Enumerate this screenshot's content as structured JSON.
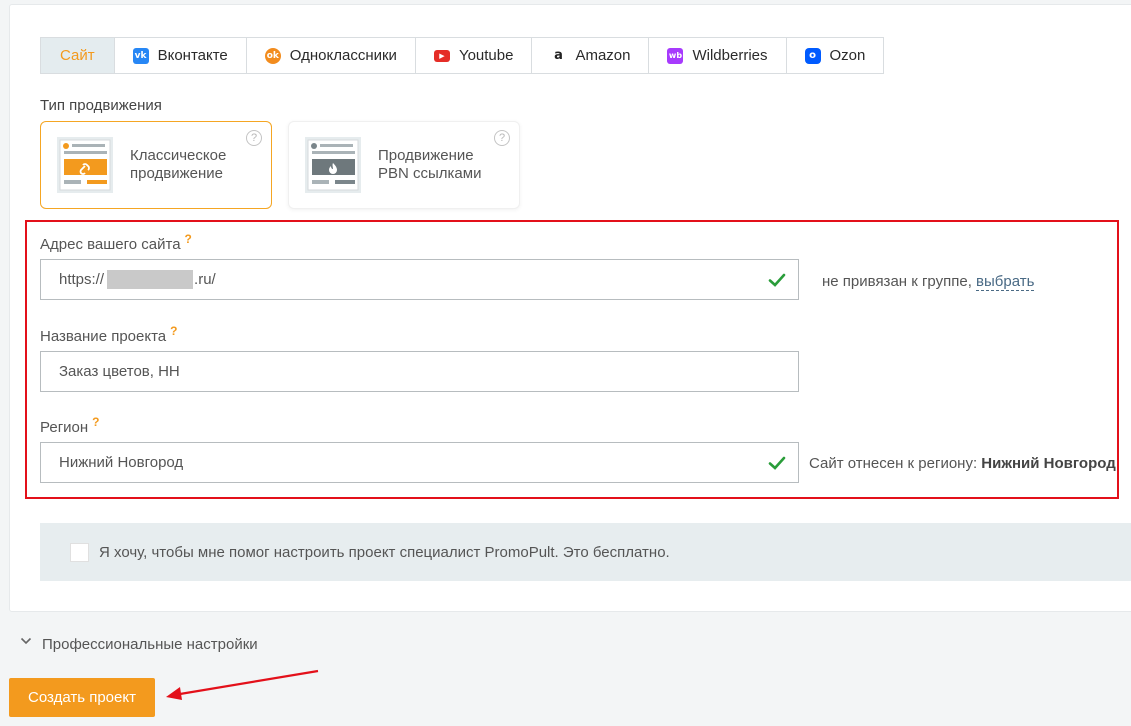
{
  "tabs": [
    {
      "label": "Сайт",
      "icon": "site-icon",
      "color": "",
      "glyph": ""
    },
    {
      "label": "Вконтакте",
      "icon": "vk-icon",
      "color": "#2787f5",
      "glyph": "vk"
    },
    {
      "label": "Одноклассники",
      "icon": "odnoklassniki-icon",
      "color": "#f28c1e",
      "glyph": "ok"
    },
    {
      "label": "Youtube",
      "icon": "youtube-icon",
      "color": "#e52d27",
      "glyph": "▶"
    },
    {
      "label": "Amazon",
      "icon": "amazon-icon",
      "color": "",
      "glyph": "a"
    },
    {
      "label": "Wildberries",
      "icon": "wildberries-icon",
      "color": "#a73afd",
      "glyph": "wb"
    },
    {
      "label": "Ozon",
      "icon": "ozon-icon",
      "color": "#005bff",
      "glyph": "o"
    }
  ],
  "promotion": {
    "label": "Тип продвижения",
    "options": [
      {
        "line1": "Классическое",
        "line2": "продвижение",
        "help": "?"
      },
      {
        "line1": "Продвижение",
        "line2": "PBN ссылками",
        "help": "?"
      }
    ]
  },
  "fields": {
    "site": {
      "label": "Адрес вашего сайта",
      "help": "?",
      "prefix": "https://",
      "suffix": ".ru/",
      "note": "не привязан к группе,",
      "note_link": "выбрать"
    },
    "project": {
      "label": "Название проекта",
      "help": "?",
      "value": "Заказ цветов, НН"
    },
    "region": {
      "label": "Регион",
      "help": "?",
      "value": "Нижний Новгород",
      "note": "Сайт отнесен к региону:",
      "note_value": "Нижний Новгород"
    }
  },
  "consult": {
    "text": "Я хочу, чтобы мне помог настроить проект специалист PromoPult. Это бесплатно.",
    "checked": false
  },
  "pro_settings": "Профессиональные настройки",
  "create_button": "Создать проект",
  "colors": {
    "accent": "#f39a1e",
    "highlight": "#e3101a",
    "valid": "#2a9d3a"
  }
}
